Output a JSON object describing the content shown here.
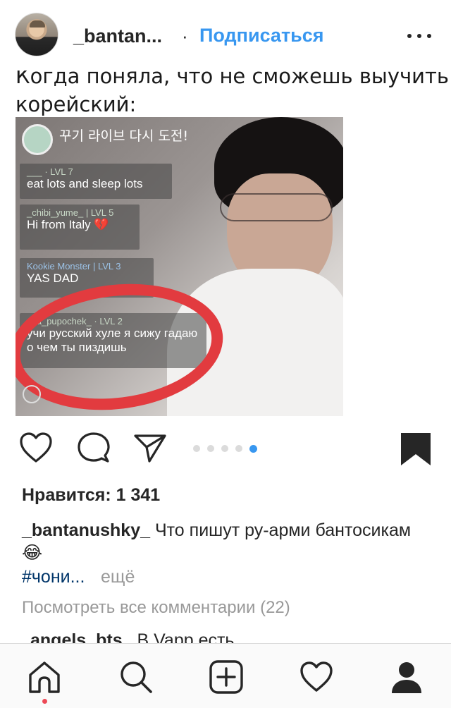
{
  "header": {
    "username": "_bantan...",
    "separator": "·",
    "follow_label": "Подписаться",
    "more_icon": "more-horizontal-icon",
    "avatar_icon": "avatar"
  },
  "post_image": {
    "caption_line1": "Когда поняла, что не сможешь выучить",
    "caption_line2": "корейский:",
    "live_title": "꾸기 라이브 다시 도전!",
    "chat": [
      {
        "name": "___",
        "level": "LVL 7",
        "text": "eat lots and sleep lots"
      },
      {
        "name": "_chibi_yume_",
        "level": "LVL 5",
        "text": "Hi from Italy 💔"
      },
      {
        "name": "Kookie Monster",
        "level": "LVL 3",
        "text": "YAS DAD"
      },
      {
        "name": "_ya_pupochek_",
        "level": "LVL 2",
        "text": "учи русский хуле я сижу гадаю о чем ты пиздишь"
      }
    ],
    "highlight_color": "#e23b3f"
  },
  "actions": {
    "like_icon": "heart-outline-icon",
    "comment_icon": "comment-bubble-icon",
    "share_icon": "paper-plane-icon",
    "save_icon": "bookmark-filled-icon",
    "carousel_total": 5,
    "carousel_active": 5,
    "accent_color": "#3897f0"
  },
  "likes": "Нравится: 1 341",
  "caption": {
    "author": "_bantanushky_",
    "text": "Что пишут ру-арми бантосикам😂",
    "hashtag": "#чони...",
    "more": "ещё"
  },
  "view_all_comments": "Посмотреть все комментарии (22)",
  "first_comment": {
    "author": "angels_bts_",
    "text": "В Vapp есть"
  },
  "tabbar": {
    "home_icon": "home-icon",
    "search_icon": "search-icon",
    "add_icon": "add-post-icon",
    "activity_icon": "heart-activity-icon",
    "profile_icon": "profile-icon"
  }
}
